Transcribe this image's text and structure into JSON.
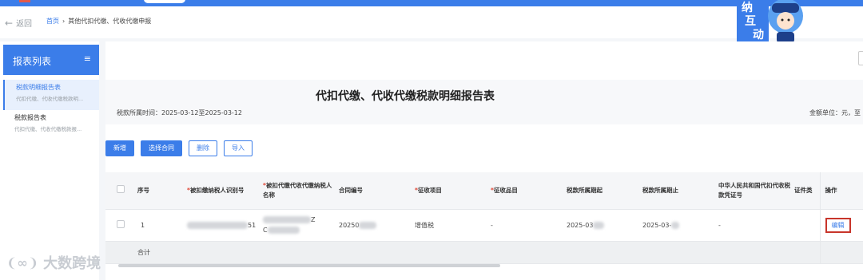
{
  "nav": {
    "back_label": "返回",
    "breadcrumb_home": "首页",
    "breadcrumb_sep": "›",
    "breadcrumb_current": "其他代扣代缴、代收代缴申报"
  },
  "mascot": {
    "text": "纳互动"
  },
  "sidebar": {
    "title": "报表列表",
    "menu_icon": "≡",
    "items": [
      {
        "label": "税款明细报告表",
        "desc": "代扣代缴、代收代缴税款明..."
      },
      {
        "label": "税款报告表",
        "desc": "代扣代缴、代收代缴税款报..."
      }
    ]
  },
  "report": {
    "title": "代扣代缴、代收代缴税款明细报告表",
    "period": "税款所属时间：2025-03-12至2025-03-12",
    "unit": "金额单位：元，至"
  },
  "toolbar": {
    "add": "新增",
    "select_contract": "选择合同",
    "delete": "删除",
    "import": "导入"
  },
  "table": {
    "headers": {
      "seq": "序号",
      "taxpayer_id": "被扣缴纳税人识别号",
      "taxpayer_name": "被扣代缴代收代缴纳税人名称",
      "contract_no": "合同编号",
      "levy_item": "征收项目",
      "levy_subitem": "征收品目",
      "period_start": "税款所属期起",
      "period_end": "税款所属期止",
      "voucher": "中华人民共和国代扣代收税款凭证号",
      "cert_type": "证件类",
      "action": "操作"
    },
    "rows": [
      {
        "seq": "1",
        "taxpayer_id_tail": "51",
        "taxpayer_name_a": "Z",
        "taxpayer_name_b": "C",
        "contract_no": "20250",
        "levy_item": "增值税",
        "levy_subitem": "-",
        "period_start": "2025-03",
        "period_end": "2025-03-",
        "voucher": "-",
        "action": "编辑"
      }
    ],
    "total_label": "合计"
  },
  "watermark": {
    "logo": "❨∞❩",
    "text": "大数跨境"
  },
  "colors": {
    "accent": "#3b7de9",
    "required": "#e04a3a",
    "highlight_box": "#c8352b"
  }
}
